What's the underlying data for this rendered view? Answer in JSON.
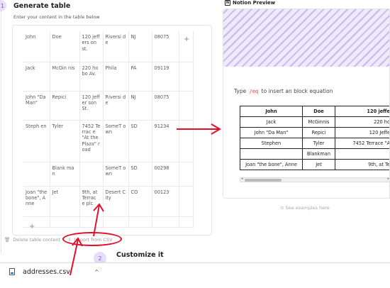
{
  "steps": {
    "step1_number": "1",
    "step1_title": "Generate table",
    "step1_subtitle": "Enter your content in the table below",
    "step2_number": "2",
    "step2_title": "Customize it"
  },
  "generator": {
    "add_column": "+",
    "add_row": "+",
    "rows": [
      [
        "John",
        "Doe",
        "120 jeffers on st.",
        "Riversi de",
        "NJ",
        "08075"
      ],
      [
        "Jack",
        "McGin nis",
        "220 hobo Av.",
        "Phila",
        "PA",
        "09119"
      ],
      [
        "John \"Da Man\"",
        "Repici",
        "120 Jeffer son St.",
        "Riversi de",
        "NJ",
        "08075"
      ],
      [
        "Steph en",
        "Tyler",
        "7452 Terrac e \"At the Plaza\" road",
        "SomeT own",
        "SD",
        "91234"
      ],
      [
        "",
        "Blank man",
        "",
        "SomeT own",
        "SD",
        "00298"
      ],
      [
        "Joan \"the bone\", Anne",
        "Jet",
        "9th, at Terrac e plc",
        "Desert City",
        "CO",
        "00123"
      ],
      [
        "",
        "",
        "",
        "",
        "",
        ""
      ]
    ],
    "delete_label": "Delete table content",
    "import_label": "Import from CSV"
  },
  "preview": {
    "label": "Notion Preview",
    "hint_prefix": "Type",
    "hint_code": "/eq",
    "hint_suffix": "to insert an block equation",
    "table": [
      [
        "John",
        "Doe",
        "120 jeffe"
      ],
      [
        "Jack",
        "McGinnis",
        "220 ho"
      ],
      [
        "John \"Da Man\"",
        "Repici",
        "120 Jeffe"
      ],
      [
        "Stephen",
        "Tyler",
        "7452 Terrace \"A"
      ],
      [
        "",
        "Blankman",
        ""
      ],
      [
        "Joan \"the bone\", Anne",
        "Jet",
        "9th, at Te"
      ]
    ],
    "see_examples": "See examples here"
  },
  "download": {
    "filename": "addresses.csv",
    "chevron": "^"
  },
  "colors": {
    "accent": "#7b5ad1",
    "annotation_red": "#e0102a"
  }
}
